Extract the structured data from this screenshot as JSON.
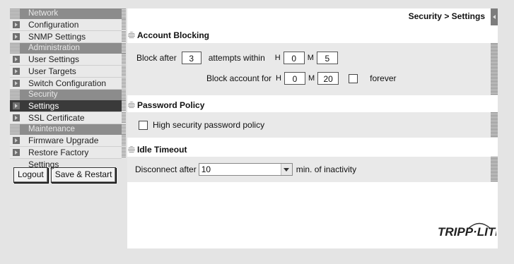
{
  "sidebar": {
    "sections": [
      {
        "title": "Network",
        "items": [
          {
            "label": "Configuration"
          },
          {
            "label": "SNMP Settings"
          }
        ]
      },
      {
        "title": "Administration",
        "items": [
          {
            "label": "User Settings"
          },
          {
            "label": "User Targets"
          },
          {
            "label": "Switch Configuration"
          }
        ]
      },
      {
        "title": "Security",
        "items": [
          {
            "label": "Settings",
            "active": true
          },
          {
            "label": "SSL Certificate"
          }
        ]
      },
      {
        "title": "Maintenance",
        "items": [
          {
            "label": "Firmware Upgrade"
          },
          {
            "label": "Restore Factory Settings"
          }
        ]
      }
    ],
    "logout_label": "Logout",
    "save_restart_label": "Save & Restart"
  },
  "header": {
    "breadcrumb": "Security > Settings"
  },
  "account_blocking": {
    "title": "Account Blocking",
    "block_after_label": "Block after",
    "attempts_value": "3",
    "attempts_within_label": "attempts within",
    "h_label": "H",
    "h_value": "0",
    "m_label": "M",
    "m_value": "5",
    "block_for_label": "Block account for",
    "block_h_value": "0",
    "block_m_value": "20",
    "forever_label": "forever"
  },
  "password_policy": {
    "title": "Password Policy",
    "high_security_label": "High security password policy"
  },
  "idle_timeout": {
    "title": "Idle Timeout",
    "disconnect_label": "Disconnect after",
    "value": "10",
    "suffix": "min. of inactivity"
  },
  "brand": {
    "logo_text": "TRIPP·LITE"
  }
}
